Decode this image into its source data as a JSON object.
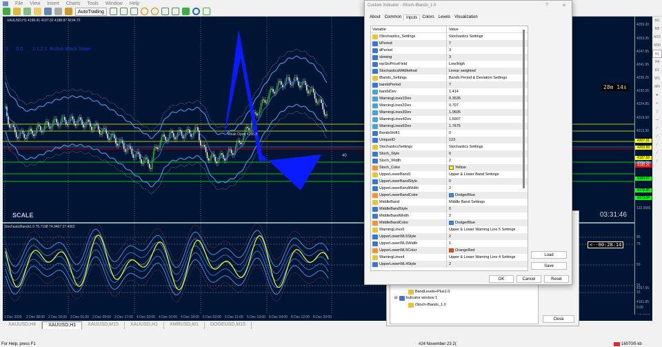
{
  "menu": [
    "File",
    "View",
    "Insert",
    "Charts",
    "Tools",
    "Window",
    "Help"
  ],
  "toolbar": {
    "autotrading": "AutoTrading"
  },
  "chart": {
    "info": "XAUUSD,H1  4196.41 4197.32 4188.87 4194.72",
    "pattern_text": "3      0.0       1:1.2:1  Bullish Black Swan",
    "level_label": "Weak Open 4195.3",
    "scale": "SCALE",
    "countdown": "28m 14s",
    "clock": "03:31:46",
    "bar_timer": "<--00:28:14",
    "sub_info": "StochasticBands1.0 75.7198 74.9467 27.4362",
    "mark_40": "40",
    "price_ticks": [
      "4259.20",
      "4253.35",
      "4247.65",
      "4241.95",
      "4236.25",
      "4230.55",
      "4224.85",
      "4219.00",
      "4213.30",
      "4201.90",
      "4167.55",
      "4161.85"
    ],
    "tagged": [
      {
        "v": "4207.31",
        "c": "#ffff00"
      },
      {
        "v": "4203.99",
        "c": "#ffff00"
      },
      {
        "v": "4197.69",
        "c": "#ffff00"
      },
      {
        "v": "4194.72",
        "c": "#4682b4"
      },
      {
        "v": "4190.25",
        "c": "#ff0000"
      },
      {
        "v": "4184.07",
        "c": "#00ff00"
      },
      {
        "v": "4178.85",
        "c": "#00ff00"
      },
      {
        "v": "4173.04",
        "c": "#00ff00"
      }
    ],
    "sub_ticks": [
      "122.9081",
      "85",
      "75",
      "50",
      "25",
      "15",
      "0.00",
      "-12.6983"
    ],
    "dates": [
      "1 Dec 2025",
      "2 Dec 08:00",
      "2 Dec 16:00",
      "3 Dec 01:00",
      "3 Dec 09:00",
      "3 Dec 17:00",
      "4 Dec 02:00",
      "4 Dec 10:00",
      "4 Dec 18:00",
      "5 Dec 02:00",
      "5 Dec 11:00",
      "5 Dec 19:00",
      "8 Dec 04:00",
      "8 Dec 12:00",
      "8 Dec 20:00"
    ]
  },
  "timeframes": [
    "M1",
    "M5",
    "M15",
    "M30",
    "H1",
    "H4",
    "D1",
    "W1",
    "MN"
  ],
  "tabs": [
    "XAUUSD,H4",
    "XAUUSD,H1",
    "XAUUSD,M15",
    "XAUUSD,H1",
    "XMRUSD,M1",
    "DOGEUSD,M15"
  ],
  "status": {
    "help": "For Help, press F1",
    "profile": "#24 November 23 2(",
    "traffic": "16070/5 kb"
  },
  "dialog": {
    "title": "Custom Indicator - iStoch-iBands_1.0",
    "help": "?",
    "close": "✕",
    "tabs": [
      "About",
      "Common",
      "Inputs",
      "Colors",
      "Levels",
      "Visualization"
    ],
    "col_variable": "Variable",
    "col_value": "Value",
    "rows": [
      {
        "t": "s",
        "n": "iStochastics_Settings",
        "v": "Stochastics Settings"
      },
      {
        "t": "i",
        "n": "kPeriod",
        "v": "7"
      },
      {
        "t": "i",
        "n": "dPeriod",
        "v": "3"
      },
      {
        "t": "i",
        "n": "slowing",
        "v": "3"
      },
      {
        "t": "i",
        "n": "inpStoPriceField",
        "v": "Low/High"
      },
      {
        "t": "i",
        "n": "StochasticsMAMethod",
        "v": "Linear weighted"
      },
      {
        "t": "s",
        "n": "iBands_Settings",
        "v": "Bands Period & Deviation Settings"
      },
      {
        "t": "i",
        "n": "bandsPeriod",
        "v": "7"
      },
      {
        "t": "d",
        "n": "bandsDev",
        "v": "1.414"
      },
      {
        "t": "d",
        "n": "WarningLines1Dev",
        "v": "0.3535"
      },
      {
        "t": "d",
        "n": "WarningLines2Dev",
        "v": "0.707"
      },
      {
        "t": "d",
        "n": "WarningLines3Dev",
        "v": "1.0605"
      },
      {
        "t": "d",
        "n": "WarningLines4Dev",
        "v": "1.5907"
      },
      {
        "t": "d",
        "n": "WarningLines5Dev",
        "v": "1.7675"
      },
      {
        "t": "i",
        "n": "BandsShift1",
        "v": "0"
      },
      {
        "t": "i",
        "n": "UniqueID",
        "v": "123"
      },
      {
        "t": "s",
        "n": "StochasticsSettings",
        "v": "Stochastics Settings"
      },
      {
        "t": "i",
        "n": "Stoch_Style",
        "v": "0"
      },
      {
        "t": "i",
        "n": "Stoch_Width",
        "v": "2"
      },
      {
        "t": "c",
        "n": "Stoch_Color",
        "v": "Yellow",
        "c": "#ffff00"
      },
      {
        "t": "s",
        "n": "UpperLowerBand1",
        "v": "Upper & Lower Band Settings"
      },
      {
        "t": "i",
        "n": "UpperLowerBandStyle",
        "v": "0"
      },
      {
        "t": "i",
        "n": "UpperLowerBandWidth",
        "v": "2"
      },
      {
        "t": "c",
        "n": "UpperLowerBandColor",
        "v": "DodgerBlue",
        "c": "#1e90ff"
      },
      {
        "t": "s",
        "n": "MiddleBand",
        "v": "Middle Band Settings"
      },
      {
        "t": "i",
        "n": "MiddleBandStyle",
        "v": "0"
      },
      {
        "t": "i",
        "n": "MiddleBandWidth",
        "v": "2"
      },
      {
        "t": "c",
        "n": "MiddleBandColor",
        "v": "DodgerBlue",
        "c": "#1e90ff"
      },
      {
        "t": "s",
        "n": "WarningLines5",
        "v": "Upper & Lower Warning Line 5 Settings"
      },
      {
        "t": "i",
        "n": "UpperLowerWL5Style",
        "v": "2"
      },
      {
        "t": "i",
        "n": "UpperLowerWL5Width",
        "v": "1"
      },
      {
        "t": "c",
        "n": "UpperLowerWL5Color",
        "v": "OrangeRed",
        "c": "#ff4500"
      },
      {
        "t": "s",
        "n": "WarningLines4",
        "v": "Upper & Lower Warning Line 4 Settings"
      },
      {
        "t": "i",
        "n": "UpperLowerWL4Style",
        "v": "2"
      }
    ],
    "load": "Load",
    "save": "Save",
    "ok": "OK",
    "cancel": "Cancel",
    "reset": "Reset"
  },
  "navigator": {
    "item1": "BandLevels+Plus1.0",
    "item2": "Indicator window 1",
    "item3": "iStoch-iBands_1.0",
    "close": "Close"
  }
}
